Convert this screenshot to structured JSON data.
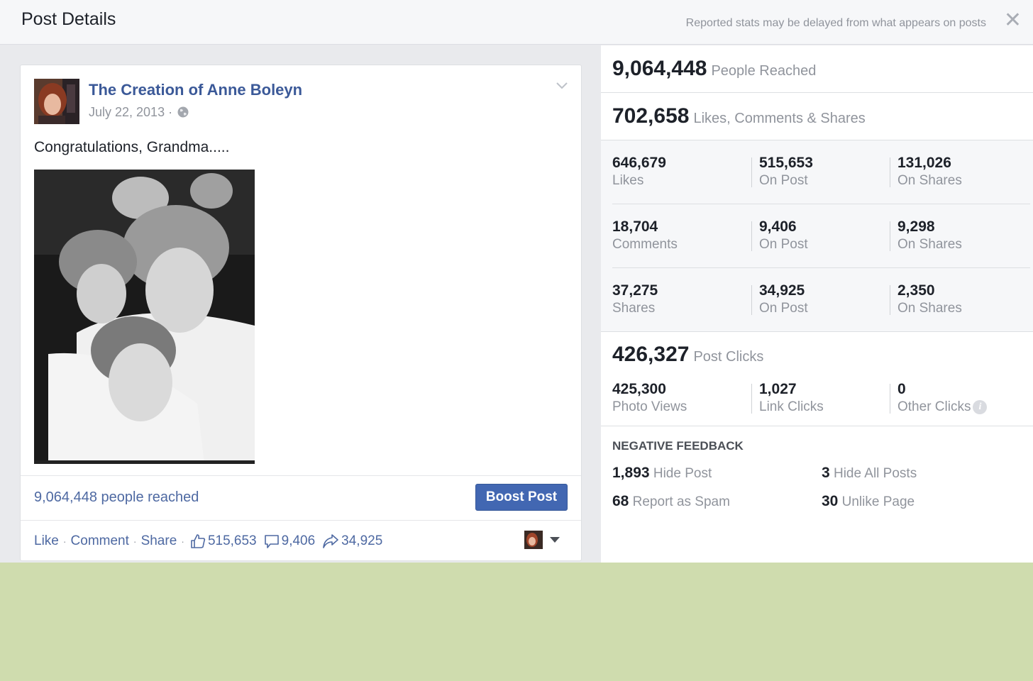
{
  "header": {
    "title": "Post Details",
    "note": "Reported stats may be delayed from what appears on posts",
    "close": "✕"
  },
  "post": {
    "page_name": "The Creation of Anne Boleyn",
    "date": "July 22, 2013 ·",
    "text": "Congratulations, Grandma.....",
    "reach": "9,064,448 people reached",
    "boost_label": "Boost Post",
    "actions": {
      "like": "Like",
      "comment": "Comment",
      "share": "Share",
      "sep": "·",
      "likes": "515,653",
      "comments": "9,406",
      "shares": "34,925"
    }
  },
  "stats": {
    "people_reached": {
      "value": "9,064,448",
      "label": "People Reached"
    },
    "engagement": {
      "value": "702,658",
      "label": "Likes, Comments & Shares"
    },
    "breakdown": [
      [
        {
          "value": "646,679",
          "label": "Likes"
        },
        {
          "value": "515,653",
          "label": "On Post"
        },
        {
          "value": "131,026",
          "label": "On Shares"
        }
      ],
      [
        {
          "value": "18,704",
          "label": "Comments"
        },
        {
          "value": "9,406",
          "label": "On Post"
        },
        {
          "value": "9,298",
          "label": "On Shares"
        }
      ],
      [
        {
          "value": "37,275",
          "label": "Shares"
        },
        {
          "value": "34,925",
          "label": "On Post"
        },
        {
          "value": "2,350",
          "label": "On Shares"
        }
      ]
    ],
    "post_clicks": {
      "value": "426,327",
      "label": "Post Clicks",
      "items": [
        {
          "value": "425,300",
          "label": "Photo Views"
        },
        {
          "value": "1,027",
          "label": "Link Clicks"
        },
        {
          "value": "0",
          "label": "Other Clicks"
        }
      ],
      "info": "i"
    },
    "negative": {
      "title": "NEGATIVE FEEDBACK",
      "items": [
        {
          "value": "1,893",
          "label": "Hide Post"
        },
        {
          "value": "3",
          "label": "Hide All Posts"
        },
        {
          "value": "68",
          "label": "Report as Spam"
        },
        {
          "value": "30",
          "label": "Unlike Page"
        }
      ]
    }
  },
  "colors": {
    "link": "#3b5998",
    "button": "#4267b2",
    "muted": "#90949c",
    "outside_background": "#cfdcae"
  }
}
